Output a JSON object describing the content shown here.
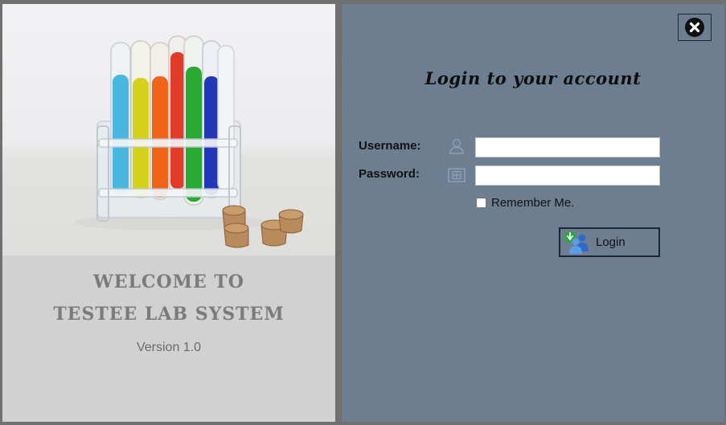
{
  "left_panel": {
    "welcome_line1": "WELCOME TO",
    "welcome_line2": "TESTEE LAB SYSTEM",
    "version": "Version 1.0"
  },
  "right_panel": {
    "title": "Login to your account",
    "username_label": "Username:",
    "password_label": "Password:",
    "username_value": "",
    "password_value": "",
    "remember_label": "Remember Me.",
    "remember_checked": false,
    "login_label": "Login"
  },
  "icons": {
    "close": "close-icon",
    "username": "user-icon",
    "password": "keypad-icon",
    "login": "users-refresh-icon"
  },
  "colors": {
    "right_background": "#6e7e91",
    "left_background": "#d1d1d1",
    "welcome_text": "#7b7b7b"
  }
}
